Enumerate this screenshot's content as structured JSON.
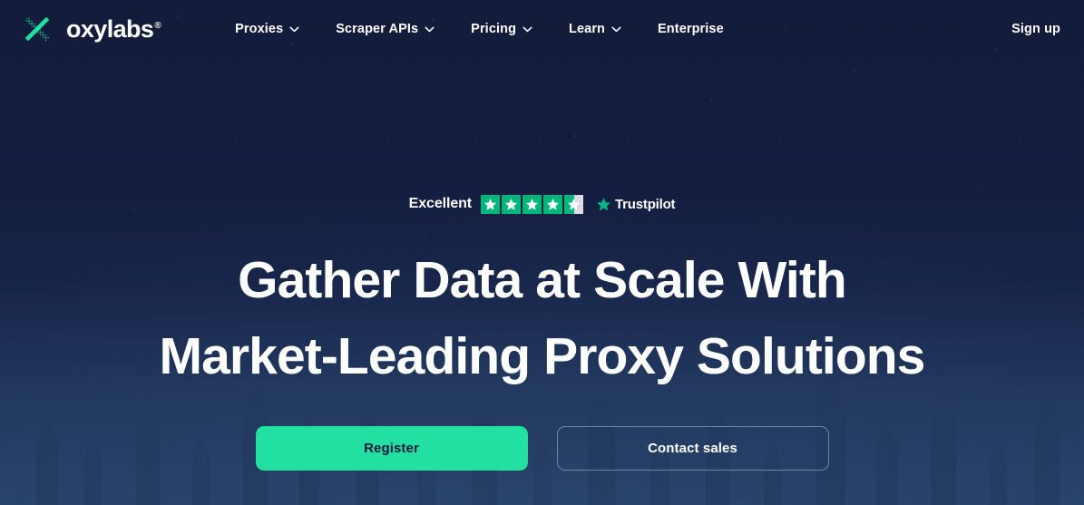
{
  "brand": {
    "name": "oxylabs",
    "registered_mark": "®",
    "logo_icon": "oxylabs-x-logo",
    "accent_color": "#22e0a1",
    "background_color": "#131c3c"
  },
  "nav": {
    "items": [
      {
        "label": "Proxies",
        "has_dropdown": true,
        "icon": "chevron-down-icon"
      },
      {
        "label": "Scraper APIs",
        "has_dropdown": true,
        "icon": "chevron-down-icon"
      },
      {
        "label": "Pricing",
        "has_dropdown": true,
        "icon": "chevron-down-icon"
      },
      {
        "label": "Learn",
        "has_dropdown": true,
        "icon": "chevron-down-icon"
      },
      {
        "label": "Enterprise",
        "has_dropdown": false,
        "icon": ""
      }
    ],
    "signup_label": "Sign up"
  },
  "hero": {
    "rating": {
      "label": "Excellent",
      "stars_total": 5,
      "stars_filled": 4,
      "half_star": true,
      "score_text": "4.5",
      "provider": "Trustpilot",
      "provider_icon": "trustpilot-star-icon",
      "star_color": "#00b67a",
      "empty_star_color": "#dcdce6"
    },
    "headline_line1": "Gather Data at Scale With",
    "headline_line2": "Market-Leading Proxy Solutions",
    "cta_primary": "Register",
    "cta_secondary": "Contact sales"
  }
}
